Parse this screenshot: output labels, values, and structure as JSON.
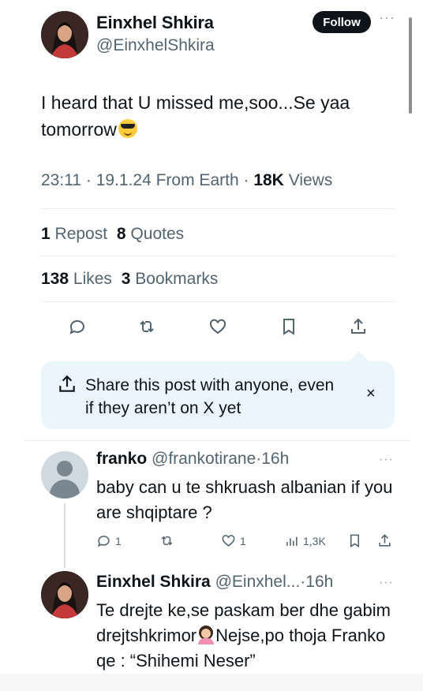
{
  "post": {
    "author_name": "Einxhel Shkira",
    "author_handle": "@EinxhelShkira",
    "follow_label": "Follow",
    "more_label": "···",
    "text": "I heard that U missed me,soo...Se yaa tomorrow",
    "emoji": "smiling-face-with-sunglasses",
    "time": "23:11",
    "date": "19.1.24",
    "source": "From Earth",
    "views_count": "18K",
    "views_label": "Views",
    "reposts_count": "1",
    "reposts_label": "Repost",
    "quotes_count": "8",
    "quotes_label": "Quotes",
    "likes_count": "138",
    "likes_label": "Likes",
    "bookmarks_count": "3",
    "bookmarks_label": "Bookmarks"
  },
  "share_prompt": {
    "text": "Share this post with anyone, even if they aren’t on X yet",
    "close_label": "×"
  },
  "replies": [
    {
      "name": "franko",
      "handle": "@frankotirane",
      "time": "16h",
      "text": "baby can u te shkruash albanian if you are shqiptare ?",
      "reply_count": "1",
      "repost_count": "",
      "like_count": "1",
      "views_count": "1,3K"
    },
    {
      "name": "Einxhel Shkira",
      "handle": "@Einxhel...",
      "time": "16h",
      "text_part1": "Te drejte ke,se paskam ber dhe gabim drejtshkrimor",
      "emoji": "woman-facepalming",
      "text_part2": "Nejse,po thoja Franko qe : “Shihemi Neser”"
    }
  ],
  "colors": {
    "text": "#0f1419",
    "secondary": "#536471",
    "share_bg": "#eaf5fc",
    "follow_bg": "#0f1419"
  }
}
